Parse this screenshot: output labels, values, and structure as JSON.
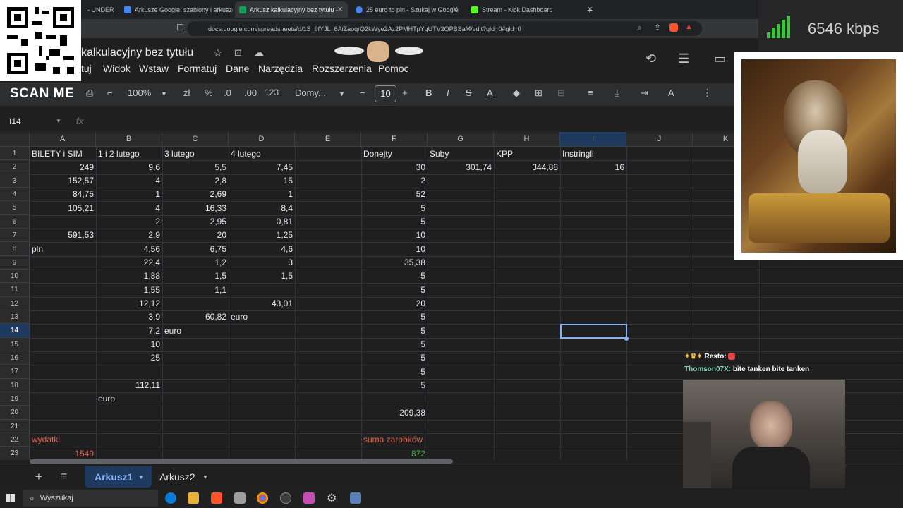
{
  "browser": {
    "tabs": [
      {
        "title": "- UNDER"
      },
      {
        "title": "Arkusze Google: szablony i arkusze k"
      },
      {
        "title": "Arkusz kalkulacyjny bez tytułu -"
      },
      {
        "title": "25 euro to pln - Szukaj w Google"
      },
      {
        "title": "Stream - Kick Dashboard"
      }
    ],
    "url": "docs.google.com/spreadsheets/d/1S_9fYJL_6AiZaoqrQ2kWye2Az2PMHTpYgUTV2QPBSaM/edit?gid=0#gid=0"
  },
  "overlay": {
    "scan_label": "SCAN ME",
    "bitrate": "6546 kbps",
    "chat": [
      {
        "user": "Resto:",
        "message": ""
      },
      {
        "user": "Thomson07X:",
        "message": "bite tanken bite tanken"
      }
    ]
  },
  "sheets": {
    "title": "kalkulacyjny bez tytułu",
    "menus": [
      "tuj",
      "Widok",
      "Wstaw",
      "Formatuj",
      "Dane",
      "Narzędzia",
      "Rozszerzenia",
      "Pomoc"
    ],
    "toolbar": {
      "zoom": "100%",
      "currency": "zł",
      "percent": "%",
      "dec_less": ".0",
      "dec_more": ".00",
      "number_format": "123",
      "font": "Domy...",
      "font_size": "10",
      "bold": "B",
      "italic": "I"
    },
    "name_box": "I14",
    "fx": "fx",
    "columns": [
      "A",
      "B",
      "C",
      "D",
      "E",
      "F",
      "G",
      "H",
      "I",
      "J",
      "K"
    ],
    "selected_column": "I",
    "selected_row": 14,
    "rows": [
      {
        "n": "1",
        "A": "BILETY i SIM",
        "B": "1 i 2 lutego",
        "C": "3 lutego",
        "D": "4 lutego",
        "F": "Donejty",
        "G": "Suby",
        "H": "KPP",
        "I": "Instringli"
      },
      {
        "n": "2",
        "A": "249",
        "B": "9,6",
        "C": "5,5",
        "D": "7,45",
        "F": "30",
        "G": "301,74",
        "H": "344,88",
        "I": "16"
      },
      {
        "n": "3",
        "A": "152,57",
        "B": "4",
        "C": "2,8",
        "D": "15",
        "F": "2"
      },
      {
        "n": "4",
        "A": "84,75",
        "B": "1",
        "C": "2,69",
        "D": "1",
        "F": "52"
      },
      {
        "n": "5",
        "A": "105,21",
        "B": "4",
        "C": "16,33",
        "D": "8,4",
        "F": "5"
      },
      {
        "n": "6",
        "B": "2",
        "C": "2,95",
        "D": "0,81",
        "F": "5"
      },
      {
        "n": "7",
        "A": "591,53",
        "B": "2,9",
        "C": "20",
        "D": "1,25",
        "F": "10"
      },
      {
        "n": "8",
        "A": "pln",
        "B": "4,56",
        "C": "6,75",
        "D": "4,6",
        "F": "10"
      },
      {
        "n": "9",
        "B": "22,4",
        "C": "1,2",
        "D": "3",
        "F": "35,38"
      },
      {
        "n": "10",
        "B": "1,88",
        "C": "1,5",
        "D": "1,5",
        "F": "5"
      },
      {
        "n": "11",
        "B": "1,55",
        "C": "1,1",
        "F": "5"
      },
      {
        "n": "12",
        "B": "12,12",
        "D": "43,01",
        "F": "20"
      },
      {
        "n": "13",
        "B": "3,9",
        "C": "60,82",
        "D": "euro",
        "F": "5"
      },
      {
        "n": "14",
        "B": "7,2",
        "C": "euro",
        "F": "5"
      },
      {
        "n": "15",
        "B": "10",
        "F": "5"
      },
      {
        "n": "16",
        "B": "25",
        "F": "5"
      },
      {
        "n": "17",
        "F": "5"
      },
      {
        "n": "18",
        "B": "112,11",
        "F": "5"
      },
      {
        "n": "19",
        "B": "euro"
      },
      {
        "n": "20",
        "F": "209,38"
      },
      {
        "n": "21"
      },
      {
        "n": "22",
        "A": "wydatki",
        "F": "suma zarobków"
      },
      {
        "n": "23",
        "A": "1549",
        "F": "872"
      }
    ],
    "sheet_tabs": [
      "Arkusz1",
      "Arkusz2"
    ],
    "active_sheet": "Arkusz1"
  },
  "taskbar": {
    "search_placeholder": "Wyszukaj"
  }
}
